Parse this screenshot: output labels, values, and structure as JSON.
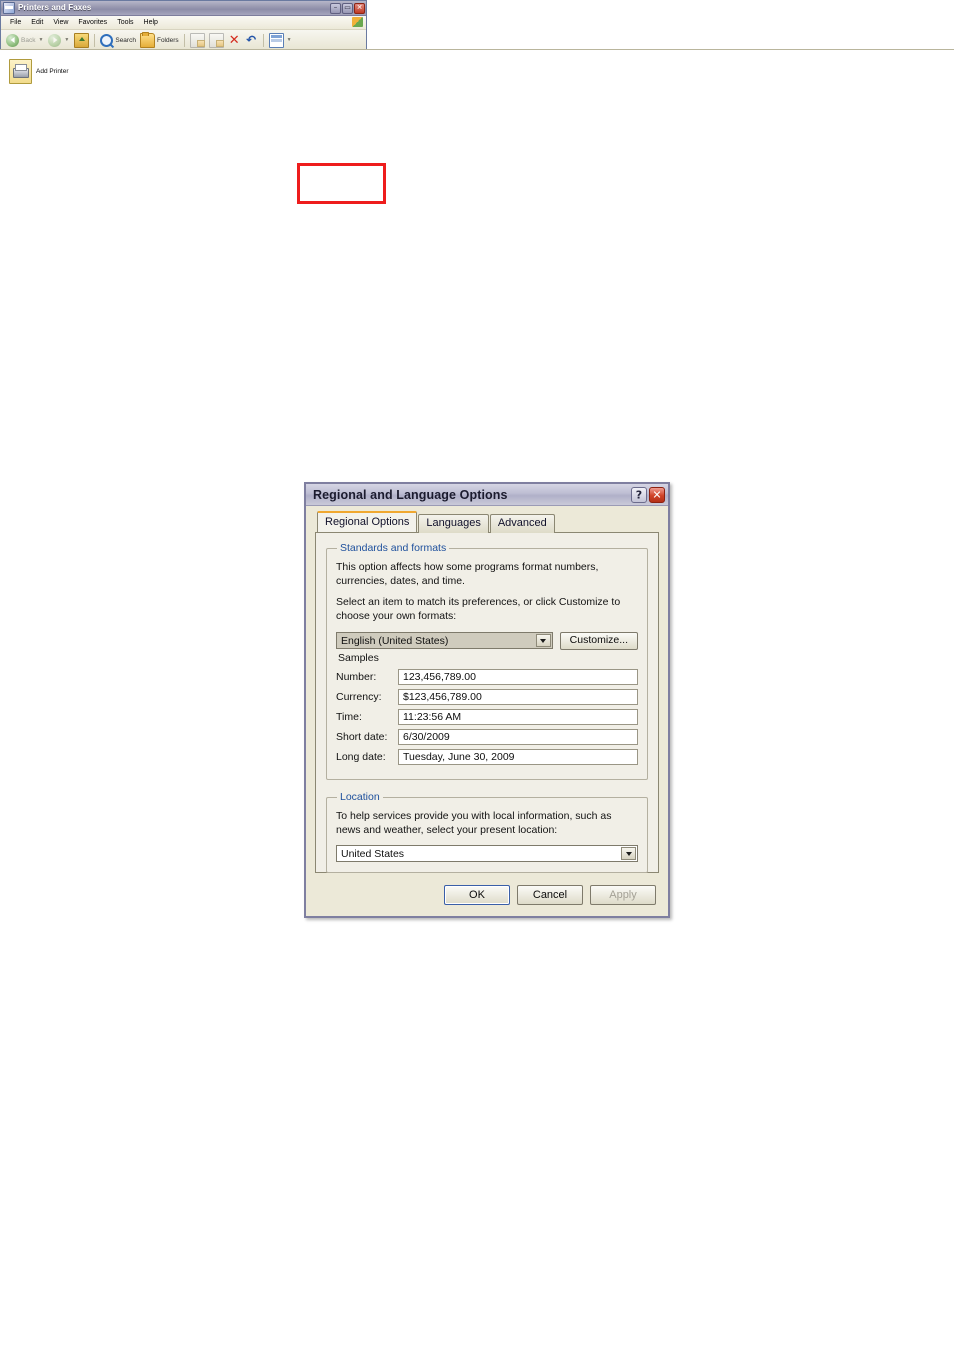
{
  "explorer_window": {
    "title": "Printers and Faxes",
    "icon": "folder-printers-icon",
    "window_buttons": {
      "minimize": "–",
      "maximize": "▭",
      "close": "✕"
    },
    "menus": [
      {
        "label": "File"
      },
      {
        "label": "Edit"
      },
      {
        "label": "View"
      },
      {
        "label": "Favorites"
      },
      {
        "label": "Tools"
      },
      {
        "label": "Help"
      }
    ],
    "toolbar": [
      {
        "label": "Back",
        "icon": "back-arrow-icon",
        "disabled": true,
        "caret": true
      },
      {
        "label": "",
        "icon": "forward-arrow-icon",
        "disabled": true,
        "caret": true
      },
      {
        "label": "",
        "icon": "up-folder-icon",
        "disabled": false,
        "caret": false
      },
      {
        "label": "Search",
        "icon": "search-icon",
        "disabled": false,
        "caret": false
      },
      {
        "label": "Folders",
        "icon": "folders-icon",
        "disabled": false,
        "caret": false
      },
      {
        "label": "",
        "icon": "move-to-icon",
        "disabled": true,
        "caret": false
      },
      {
        "label": "",
        "icon": "copy-to-icon",
        "disabled": true,
        "caret": false
      },
      {
        "label": "",
        "icon": "delete-icon",
        "disabled": false,
        "caret": false
      },
      {
        "label": "",
        "icon": "undo-icon",
        "disabled": false,
        "caret": false
      },
      {
        "label": "",
        "icon": "views-icon",
        "disabled": false,
        "caret": true
      }
    ],
    "items": [
      {
        "label": "Add Printer",
        "icon": "add-printer-icon"
      }
    ],
    "highlight_color": "#ee1c1c"
  },
  "regional_dialog": {
    "title": "Regional and Language Options",
    "help_button": "?",
    "close_button": "✕",
    "tabs": [
      {
        "label": "Regional Options",
        "active": true
      },
      {
        "label": "Languages",
        "active": false
      },
      {
        "label": "Advanced",
        "active": false
      }
    ],
    "active_tab_accent": "#f0a830",
    "standards_group": {
      "legend": "Standards and formats",
      "description": "This option affects how some programs format numbers, currencies, dates, and time.",
      "instruction": "Select an item to match its preferences, or click Customize to choose your own formats:",
      "locale_value": "English (United States)",
      "customize_button": "Customize...",
      "samples_title": "Samples",
      "samples": [
        {
          "label": "Number:",
          "value": "123,456,789.00"
        },
        {
          "label": "Currency:",
          "value": "$123,456,789.00"
        },
        {
          "label": "Time:",
          "value": "11:23:56 AM"
        },
        {
          "label": "Short date:",
          "value": "6/30/2009"
        },
        {
          "label": "Long date:",
          "value": "Tuesday, June 30, 2009"
        }
      ]
    },
    "location_group": {
      "legend": "Location",
      "description": "To help services provide you with local information, such as news and weather, select your present location:",
      "location_value": "United States"
    },
    "buttons": [
      {
        "label": "OK",
        "default": true,
        "disabled": false
      },
      {
        "label": "Cancel",
        "default": false,
        "disabled": false
      },
      {
        "label": "Apply",
        "default": false,
        "disabled": true
      }
    ]
  }
}
